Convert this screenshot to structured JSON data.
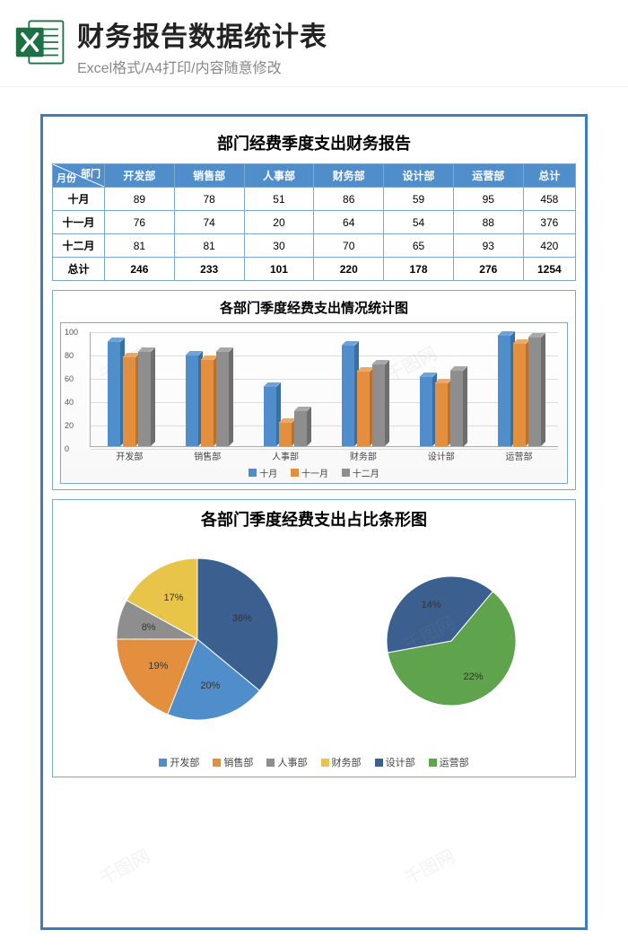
{
  "header": {
    "title": "财务报告数据统计表",
    "subtitle": "Excel格式/A4打印/内容随意修改"
  },
  "report_title": "部门经费季度支出财务报告",
  "table": {
    "corner_top": "部门",
    "corner_bottom": "月份",
    "columns": [
      "开发部",
      "销售部",
      "人事部",
      "财务部",
      "设计部",
      "运营部",
      "总计"
    ],
    "rows": [
      {
        "label": "十月",
        "values": [
          89,
          78,
          51,
          86,
          59,
          95,
          458
        ]
      },
      {
        "label": "十一月",
        "values": [
          76,
          74,
          20,
          64,
          54,
          88,
          376
        ]
      },
      {
        "label": "十二月",
        "values": [
          81,
          81,
          30,
          70,
          65,
          93,
          420
        ]
      }
    ],
    "total": {
      "label": "总计",
      "values": [
        246,
        233,
        101,
        220,
        178,
        276,
        1254
      ]
    }
  },
  "bar_chart": {
    "title": "各部门季度经费支出情况统计图",
    "legend": [
      "十月",
      "十一月",
      "十二月"
    ]
  },
  "pie_chart": {
    "title": "各部门季度经费支出占比条形图",
    "legend": [
      "开发部",
      "销售部",
      "人事部",
      "财务部",
      "设计部",
      "运营部"
    ]
  },
  "colors": {
    "series": [
      "#4f8ecb",
      "#e38f3e",
      "#8e8e8e",
      "#e8c548",
      "#3b5f8f",
      "#5fa34d"
    ],
    "series3d": {
      "blue_dark": "#2f5a8a",
      "green_dark": "#4a823c",
      "green_light": "#79b46a"
    }
  },
  "chart_data": [
    {
      "type": "bar",
      "title": "各部门季度经费支出情况统计图",
      "categories": [
        "开发部",
        "销售部",
        "人事部",
        "财务部",
        "设计部",
        "运营部"
      ],
      "series": [
        {
          "name": "十月",
          "values": [
            89,
            78,
            51,
            86,
            59,
            95
          ]
        },
        {
          "name": "十一月",
          "values": [
            76,
            74,
            20,
            64,
            54,
            88
          ]
        },
        {
          "name": "十二月",
          "values": [
            81,
            81,
            30,
            70,
            65,
            93
          ]
        }
      ],
      "ylabel": "",
      "xlabel": "",
      "ylim": [
        0,
        100
      ],
      "yticks": [
        0,
        20,
        40,
        60,
        80,
        100
      ]
    },
    {
      "type": "pie",
      "title": "各部门季度经费支出占比条形图",
      "subcharts": [
        {
          "labels": [
            "开发部",
            "销售部",
            "人事部",
            "财务部",
            "设计部"
          ],
          "values": [
            36,
            20,
            19,
            8,
            17
          ],
          "display_percent": [
            "36%",
            "20%",
            "19%",
            "8%",
            "17%"
          ]
        },
        {
          "labels": [
            "设计部",
            "运营部"
          ],
          "values": [
            14,
            22
          ],
          "display_percent": [
            "14%",
            "22%"
          ],
          "note": "partial-explode"
        }
      ],
      "legend": [
        "开发部",
        "销售部",
        "人事部",
        "财务部",
        "设计部",
        "运营部"
      ]
    }
  ],
  "watermark": "千图网"
}
